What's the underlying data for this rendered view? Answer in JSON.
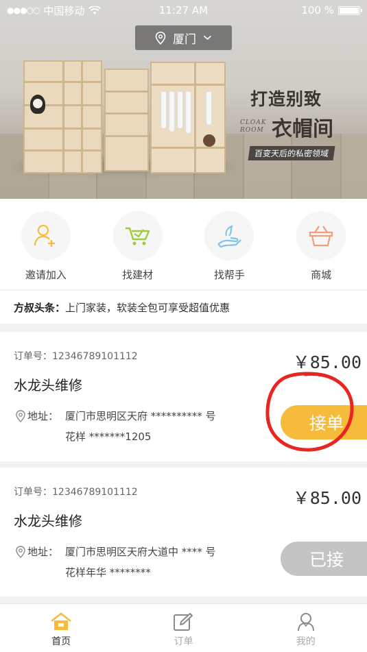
{
  "status_bar": {
    "carrier": "中国移动",
    "time": "11:27 AM",
    "battery": "100 %",
    "battery_level": 1.0
  },
  "city_selector": {
    "city": "厦门",
    "icon": "location-pin-icon"
  },
  "banner": {
    "headline": "打造别致",
    "headline_2": "衣帽间",
    "english": "CLOAK ROOM",
    "tagline": "百变天后的私密领域"
  },
  "categories": [
    {
      "label": "邀请加入",
      "icon": "user-add-icon",
      "color": "#f7bb3b"
    },
    {
      "label": "找建材",
      "icon": "cart-icon",
      "color": "#9ccc3a"
    },
    {
      "label": "找帮手",
      "icon": "helping-hand-icon",
      "color": "#7fc4e6"
    },
    {
      "label": "商城",
      "icon": "basket-icon",
      "color": "#f29c7f"
    }
  ],
  "headline_news": {
    "label": "方叔头条：",
    "text": "上门家装，软装全包可享受超值优惠"
  },
  "orders": [
    {
      "order_no": "订单号：12346789101112",
      "price": "￥85.00",
      "title": "水龙头维修",
      "addr_label": "地址：",
      "addr_line1": "厦门市思明区天府 ********** 号",
      "addr_line2": "花样 *******1205",
      "action": "接单",
      "status": "pending"
    },
    {
      "order_no": "订单号：12346789101112",
      "price": "￥85.00",
      "title": "水龙头维修",
      "addr_label": "地址：",
      "addr_line1": "厦门市思明区天府大道中 **** 号",
      "addr_line2": "花样年华 ********",
      "action": "已接",
      "status": "accepted"
    }
  ],
  "tabbar": [
    {
      "label": "首页",
      "icon": "home-icon",
      "active": true
    },
    {
      "label": "订单",
      "icon": "edit-order-icon",
      "active": false
    },
    {
      "label": "我的",
      "icon": "profile-icon",
      "active": false
    }
  ],
  "colors": {
    "accent": "#f7bb3b",
    "accepted": "#c4c4c4",
    "annotation": "#e8261f"
  }
}
